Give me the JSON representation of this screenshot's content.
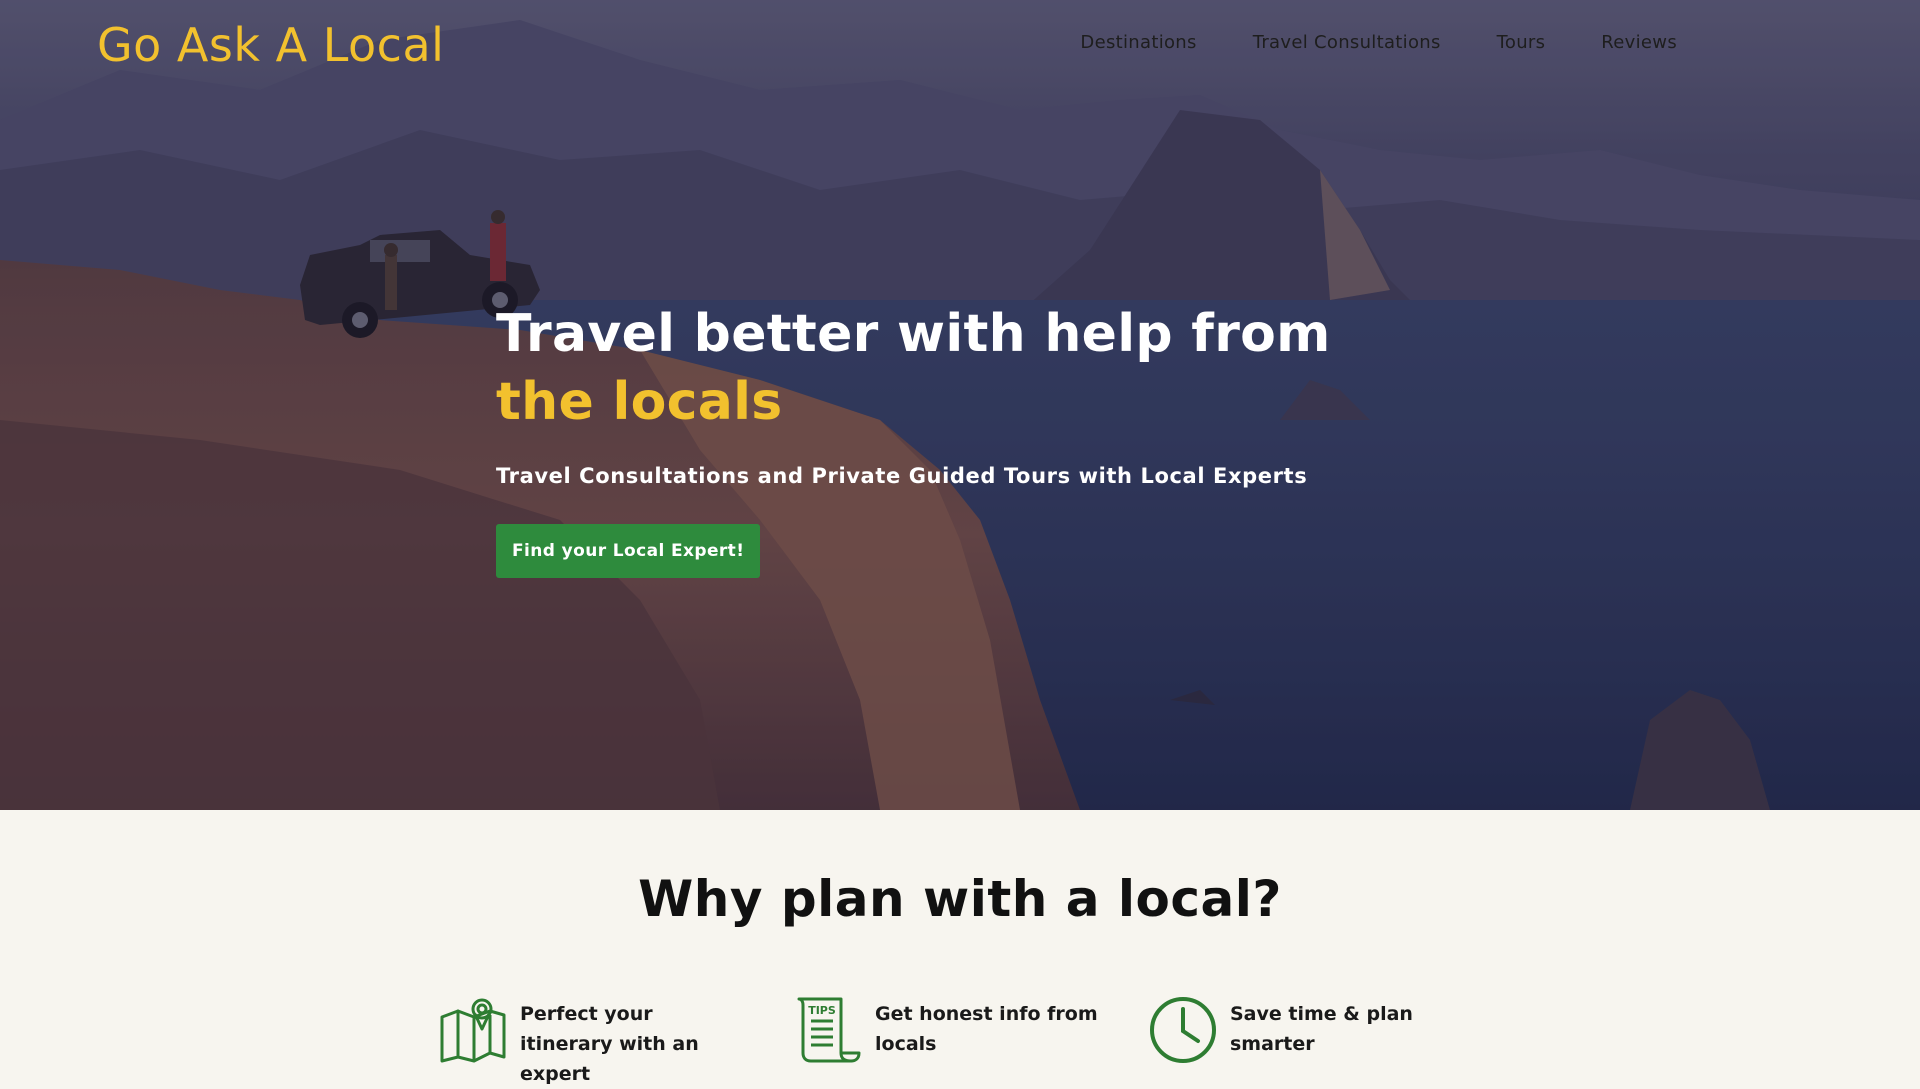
{
  "brand": {
    "name": "Go Ask A Local"
  },
  "nav": {
    "items": [
      {
        "label": "Destinations"
      },
      {
        "label": "Travel Consultations"
      },
      {
        "label": "Tours"
      },
      {
        "label": "Reviews"
      }
    ]
  },
  "hero": {
    "headline_main": "Travel better with help from ",
    "headline_accent": "the locals",
    "subheadline": "Travel Consultations and Private Guided Tours with Local Experts",
    "cta_label": "Find your Local Expert!"
  },
  "why": {
    "title": "Why plan with a local?",
    "features": [
      {
        "icon": "map-pin-icon",
        "text": "Perfect your itinerary with an expert"
      },
      {
        "icon": "tips-scroll-icon",
        "text": "Get honest info from locals"
      },
      {
        "icon": "clock-icon",
        "text": "Save time & plan smarter"
      }
    ]
  },
  "colors": {
    "accent_yellow": "#f2c12e",
    "brand_green": "#2e8b3d",
    "page_background": "#f7f5ef",
    "icon_green": "#2e7d32"
  }
}
